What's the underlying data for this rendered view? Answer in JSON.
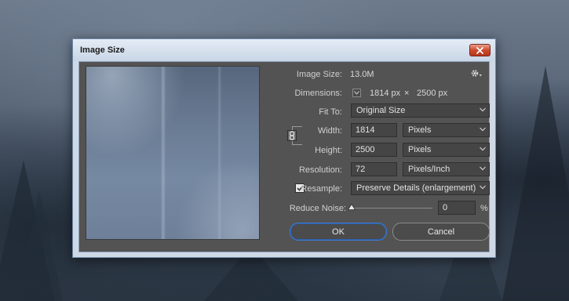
{
  "window": {
    "title": "Image Size"
  },
  "info": {
    "image_size_label": "Image Size:",
    "image_size_value": "13.0M",
    "dimensions_label": "Dimensions:",
    "dim_width": "1814 px",
    "dim_x": "×",
    "dim_height": "2500 px"
  },
  "fit_to": {
    "label": "Fit To:",
    "value": "Original Size"
  },
  "width": {
    "label": "Width:",
    "value": "1814",
    "unit": "Pixels"
  },
  "height": {
    "label": "Height:",
    "value": "2500",
    "unit": "Pixels"
  },
  "resolution": {
    "label": "Resolution:",
    "value": "72",
    "unit": "Pixels/Inch"
  },
  "resample": {
    "label": "Resample:",
    "checked": true,
    "value": "Preserve Details (enlargement)"
  },
  "reduce_noise": {
    "label": "Reduce Noise:",
    "value": "0",
    "unit": "%",
    "level": 0
  },
  "buttons": {
    "ok": "OK",
    "cancel": "Cancel"
  },
  "icons": {
    "settings": "gear-icon",
    "close": "close-icon",
    "link": "link-chain-icon",
    "dropdown": "chevron-down-icon",
    "check": "checkmark-icon"
  },
  "colors": {
    "dialog_bg": "#535353",
    "field_bg": "#454545",
    "ok_focus": "#3d7ad4",
    "close_button": "#cf4a2e"
  }
}
